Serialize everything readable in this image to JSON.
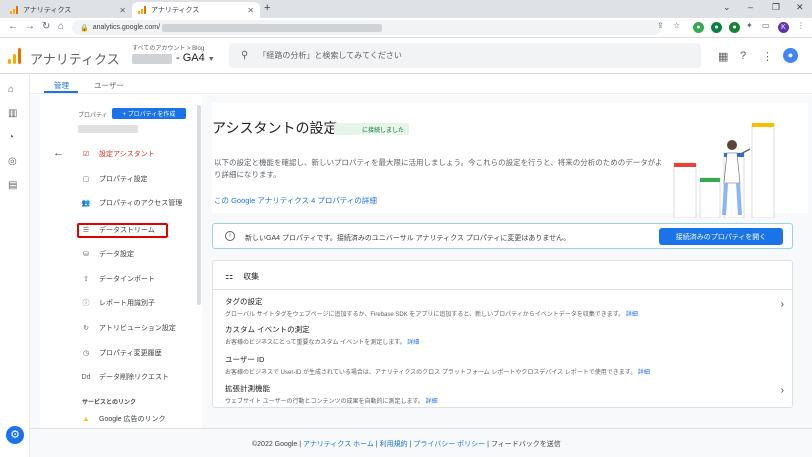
{
  "browser": {
    "tabs": [
      {
        "title": "アナリティクス",
        "active": false
      },
      {
        "title": "アナリティクス",
        "active": true
      }
    ],
    "new_tab": "+",
    "url": "analytics.google.com/",
    "profile_initial": "K",
    "window_controls": [
      "⌄",
      "–",
      "❐",
      "✕"
    ]
  },
  "header": {
    "app_title": "アナリティクス",
    "account_crumb": "すべてのアカウント > Blog",
    "property_name": "- GA4",
    "search_placeholder": "「経路の分析」と検索してみてください"
  },
  "admin_tabs": [
    {
      "label": "管理",
      "active": true
    },
    {
      "label": "ユーザー",
      "active": false
    }
  ],
  "property_nav": {
    "label": "プロパティ",
    "create_button": "+ プロパティを作成",
    "items": [
      {
        "label": "設定アシスタント",
        "icon": "checklist-icon",
        "active": true
      },
      {
        "label": "プロパティ設定",
        "icon": "property-icon"
      },
      {
        "label": "プロパティのアクセス管理",
        "icon": "people-icon"
      },
      {
        "label": "データストリーム",
        "icon": "stream-icon"
      },
      {
        "label": "データ設定",
        "icon": "database-icon"
      },
      {
        "label": "データインポート",
        "icon": "upload-icon"
      },
      {
        "label": "レポート用識別子",
        "icon": "id-icon"
      },
      {
        "label": "アトリビューション設定",
        "icon": "attribution-icon"
      },
      {
        "label": "プロパティ変更履歴",
        "icon": "history-icon"
      },
      {
        "label": "データ削除リクエスト",
        "icon": "delete-request-icon"
      }
    ],
    "section": "サービスとのリンク",
    "link_item": "Google 広告のリンク"
  },
  "assistant": {
    "title": "アシスタントの設定",
    "connected_chip": "に接続しました",
    "intro": "以下の設定と機能を確認し、新しいプロパティを最大限に活用しましょう。今これらの設定を行うと、将来の分析のためのデータがより詳細になります。",
    "learn_link": "この Google アナリティクス 4 プロパティの詳細"
  },
  "banner": {
    "message": "新しいGA4 プロパティです。接続済みのユニバーサル アナリティクス プロパティに変更はありません。",
    "button": "接続済みのプロパティを開く"
  },
  "collect": {
    "header": "収集",
    "rows": [
      {
        "title": "タグの設定",
        "desc": "グローバル サイトタグをウェブページに追加するか、Firebase SDK をアプリに追加すると、新しいプロパティからイベントデータを収集できます。",
        "link": "詳細",
        "chevron": true
      },
      {
        "title": "カスタム イベントの測定",
        "desc": "お客様のビジネスにとって重要なカスタム イベントを測定します。",
        "link": "詳細",
        "chevron": false
      },
      {
        "title": "ユーザー ID",
        "desc": "お客様のビジネスで User-ID が生成されている場合は、アナリティクスのクロス プラットフォーム レポートやクロスデバイス レポートで使用できます。",
        "link": "詳細",
        "chevron": false
      },
      {
        "title": "拡張計測機能",
        "desc": "ウェブサイト ユーザーの行動とコンテンツの成果を自動的に測定します。",
        "link": "詳細",
        "chevron": true
      }
    ]
  },
  "footer": {
    "copyright": "©2022 Google",
    "links": [
      "アナリティクス ホーム",
      "利用規約",
      "プライバシー ポリシー"
    ],
    "feedback": "フィードバックを送信"
  },
  "colors": {
    "accent": "#1a73e8",
    "highlight": "#e00000",
    "logo": [
      "#f9ab00",
      "#e37400"
    ]
  }
}
